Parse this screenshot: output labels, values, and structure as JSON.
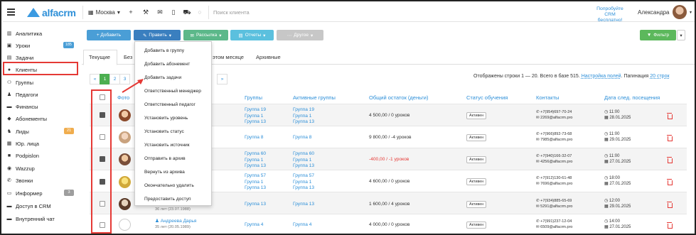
{
  "topbar": {
    "logo": "alfacrm",
    "city": "Москва",
    "search_placeholder": "Поиск клиента",
    "promo": "Попробуйте CRM бесплатно!",
    "username": "Александра"
  },
  "sidebar": {
    "items": [
      {
        "label": "Аналитика",
        "icon": "chart-icon"
      },
      {
        "label": "Уроки",
        "icon": "calendar-icon",
        "badge": "185",
        "badge_color": "#4a9ed6"
      },
      {
        "label": "Задачи",
        "icon": "tasks-icon"
      },
      {
        "label": "Клиенты",
        "icon": "user-icon"
      },
      {
        "label": "Группы",
        "icon": "users-icon"
      },
      {
        "label": "Педагоги",
        "icon": "teacher-icon"
      },
      {
        "label": "Финансы",
        "icon": "finance-icon"
      },
      {
        "label": "Абонементы",
        "icon": "tag-icon"
      },
      {
        "label": "Лиды",
        "icon": "lead-icon",
        "badge": "21",
        "badge_color": "#f0ad4e"
      },
      {
        "label": "Юр. лица",
        "icon": "building-icon"
      },
      {
        "label": "Podpislon",
        "icon": "podpislon-icon"
      },
      {
        "label": "Wazzup",
        "icon": "whatsapp-icon"
      },
      {
        "label": "Звонки",
        "icon": "phone-icon"
      },
      {
        "label": "Информер",
        "icon": "informer-icon",
        "badge": "3",
        "badge_color": "#9e9e9e"
      },
      {
        "label": "Доступ в CRM",
        "icon": "lock-icon"
      },
      {
        "label": "Внутренний чат",
        "icon": "chat-icon"
      }
    ]
  },
  "toolbar": {
    "add": "+ Добавить",
    "edit": "Править",
    "mailing": "Рассылка",
    "reports": "Отчеты",
    "other": "Другое",
    "filter": "Фильтр",
    "colors": {
      "add": "#4a9ed6",
      "edit": "#3a7fbf",
      "mailing": "#5cb88a",
      "reports": "#5bc0de",
      "other": "#c7c7c7",
      "filter": "#5cb85c"
    }
  },
  "tabs": [
    "Текущие",
    "Без",
    "этом месяце",
    "Архивные"
  ],
  "pager": {
    "pages": [
      "«",
      "1",
      "2",
      "3",
      "»"
    ],
    "summary": "Отображены строки 1 — 20. Всего в базе 515.",
    "settings_link": "Настройка полей",
    "pagination_label": "Пагинация",
    "pagination_value": "20 строк"
  },
  "table": {
    "headers": {
      "photo": "Фото",
      "groups": "Группы",
      "active_groups": "Активные группы",
      "balance": "Общий остаток (деньги)",
      "status": "Статус обучения",
      "contacts": "Контакты",
      "next_visit": "Дата след. посещения"
    },
    "rows": [
      {
        "checked": true,
        "groups": [
          "Группа 19",
          "Группа 1",
          "Группа 13"
        ],
        "active": [
          "Группа 19",
          "Группа 1",
          "Группа 13"
        ],
        "balance": "4 500,00 / 0 уроков",
        "neg": false,
        "status": "Активен",
        "phone": "+7(954)697-70-24",
        "email": "2269@alfacrm.pro",
        "time": "11:00",
        "date": "28.01.2025"
      },
      {
        "checked": false,
        "groups": [
          "Группа 8"
        ],
        "active": [
          "Группа 8"
        ],
        "balance": "9 800,00 / -4 уроков",
        "neg": false,
        "status": "Активен",
        "phone": "+7(966)892-73-68",
        "email": "7985@alfacrm.pro",
        "time": "11:00",
        "date": "29.01.2025"
      },
      {
        "checked": true,
        "groups": [
          "Группа 60",
          "Группа 1",
          "Группа 13"
        ],
        "active": [
          "Группа 60",
          "Группа 1",
          "Группа 13"
        ],
        "balance": "-400,00 / -1 уроков",
        "neg": true,
        "status": "Активен",
        "phone": "+7(940)166-32-07",
        "email": "4256@alfacrm.pro",
        "time": "11:00",
        "date": "27.01.2025"
      },
      {
        "checked": true,
        "groups": [
          "Группа 57",
          "Группа 1",
          "Группа 13"
        ],
        "active": [
          "Группа 57",
          "Группа 1",
          "Группа 13"
        ],
        "balance": "4 600,00 / 0 уроков",
        "neg": false,
        "status": "Активен",
        "phone": "+7(912)130-61-48",
        "email": "7696@alfacrm.pro",
        "time": "18:00",
        "date": "27.01.2025"
      },
      {
        "checked": false,
        "groups": [
          "Группа 13"
        ],
        "active": [
          "Группа 13"
        ],
        "balance": "1 600,00 / 4 уроков",
        "neg": false,
        "status": "Активен",
        "phone": "+7(934)885-65-69",
        "email": "5291@alfacrm.pro",
        "time": "12:00",
        "date": "29.01.2025",
        "age": "36 лет (23.07.1988)"
      },
      {
        "checked": false,
        "groups": [
          "Группа 4"
        ],
        "active": [
          "Группа 4"
        ],
        "balance": "4 000,00 / 0 уроков",
        "neg": false,
        "status": "Активен",
        "phone": "+7(991)237-12-04",
        "email": "6509@alfacrm.pro",
        "time": "14:00",
        "date": "27.01.2025",
        "name": "Андреева Дарья",
        "age": "35 лет (20.05.1989)"
      }
    ]
  },
  "dropdown": {
    "items": [
      "Добавить в группу",
      "Добавить абонемент",
      "Добавить задачи",
      "Ответственный менеджер",
      "Ответственный педагог",
      "Установить уровень",
      "Установить статус",
      "Установить источник",
      "Отправить в архив",
      "Вернуть из архива",
      "Окончательно удалить",
      "Предоставить доступ"
    ]
  }
}
